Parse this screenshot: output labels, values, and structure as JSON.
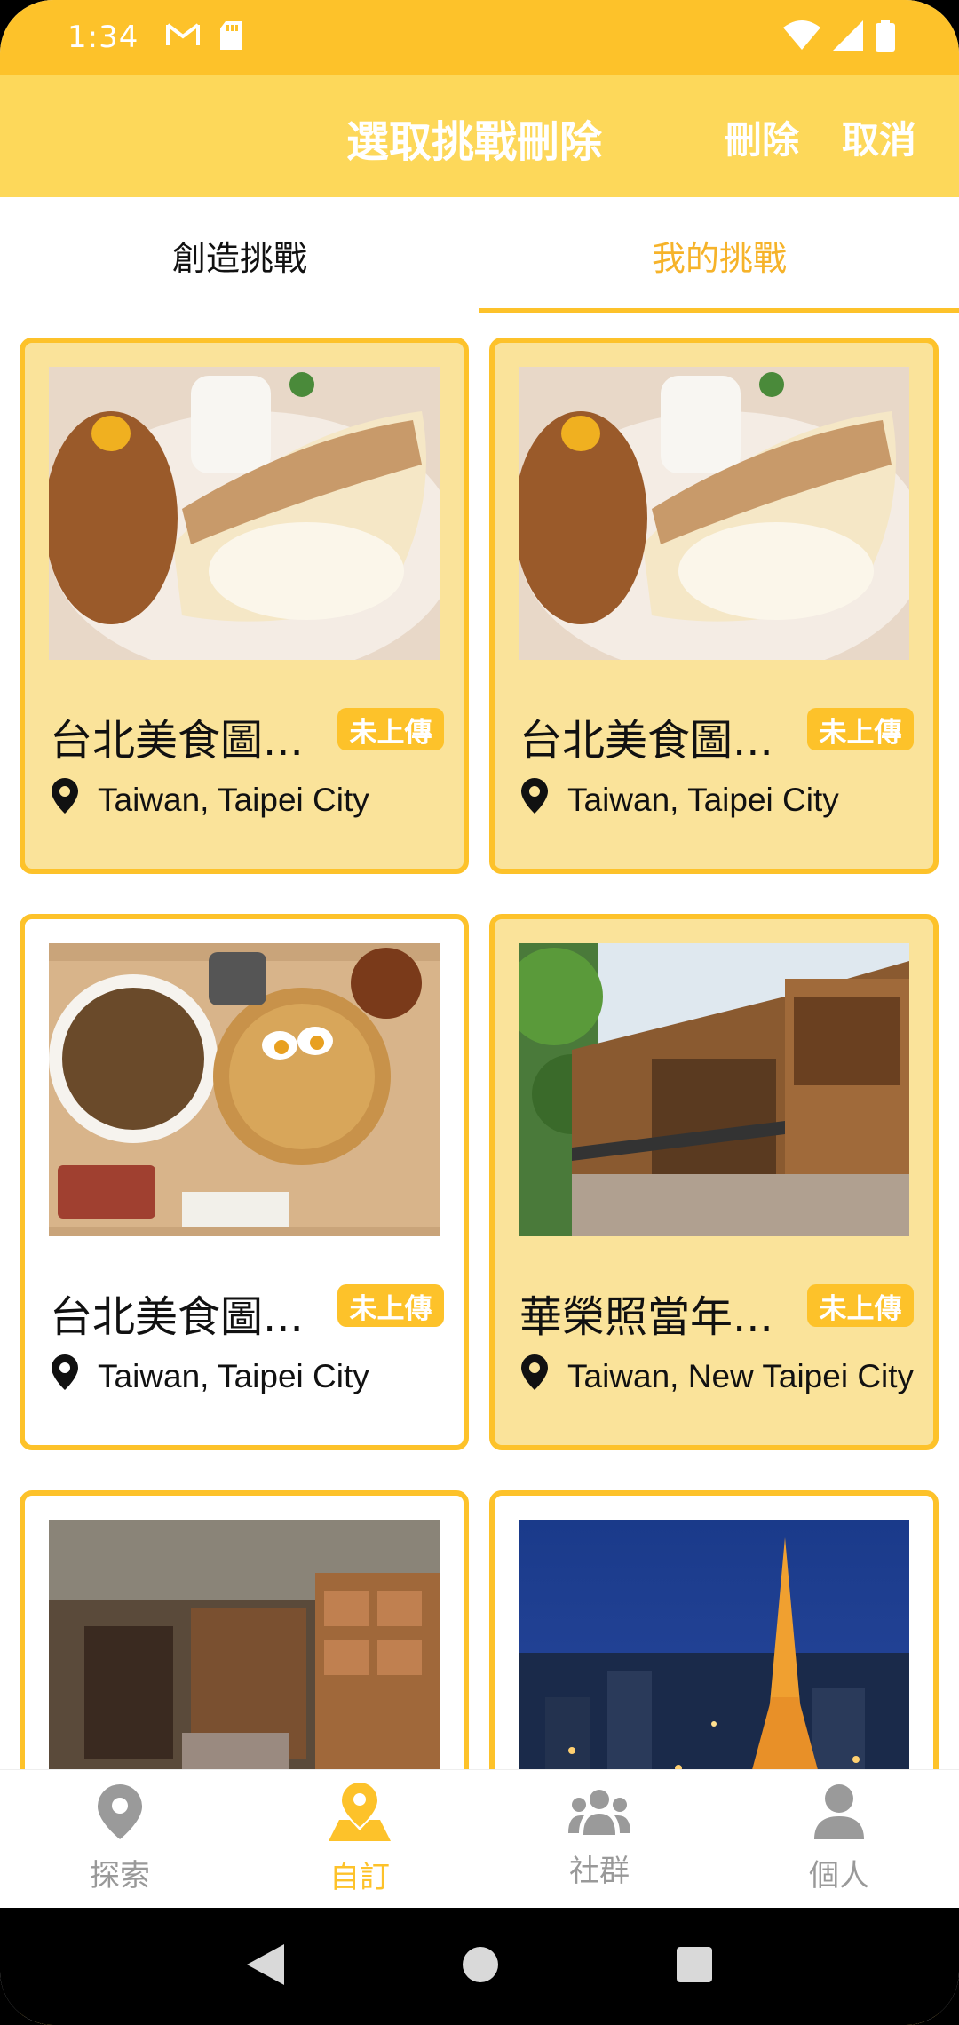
{
  "status_bar": {
    "time": "1:34"
  },
  "app_bar": {
    "title": "選取挑戰刪除",
    "delete_label": "刪除",
    "cancel_label": "取消"
  },
  "tabs": [
    {
      "label": "創造挑戰",
      "active": false
    },
    {
      "label": "我的挑戰",
      "active": true
    }
  ],
  "cards": [
    {
      "title": "台北美食圖...",
      "badge": "未上傳",
      "location": "Taiwan, Taipei City",
      "selected": true,
      "image": "souffle-pancake-photo"
    },
    {
      "title": "台北美食圖...",
      "badge": "未上傳",
      "location": "Taiwan, Taipei City",
      "selected": true,
      "image": "souffle-pancake-photo"
    },
    {
      "title": "台北美食圖...",
      "badge": "未上傳",
      "location": "Taiwan, Taipei City",
      "selected": false,
      "image": "noodle-soup-photo"
    },
    {
      "title": "華榮照當年...",
      "badge": "未上傳",
      "location": "Taiwan, New Taipei City",
      "selected": true,
      "image": "wooden-house-photo"
    },
    {
      "title": "",
      "badge": "",
      "location": "",
      "selected": false,
      "image": "bookstore-cafe-photo"
    },
    {
      "title": "",
      "badge": "",
      "location": "",
      "selected": false,
      "image": "tokyo-tower-night-photo"
    }
  ],
  "bottom_nav": [
    {
      "label": "探索",
      "icon": "map-pin-icon",
      "active": false
    },
    {
      "label": "自訂",
      "icon": "map-marker-custom-icon",
      "active": true
    },
    {
      "label": "社群",
      "icon": "people-icon",
      "active": false
    },
    {
      "label": "個人",
      "icon": "person-icon",
      "active": false
    }
  ],
  "colors": {
    "accent": "#FDC22A",
    "appbar": "#FDD85A",
    "selected_card": "#FAE39A"
  }
}
